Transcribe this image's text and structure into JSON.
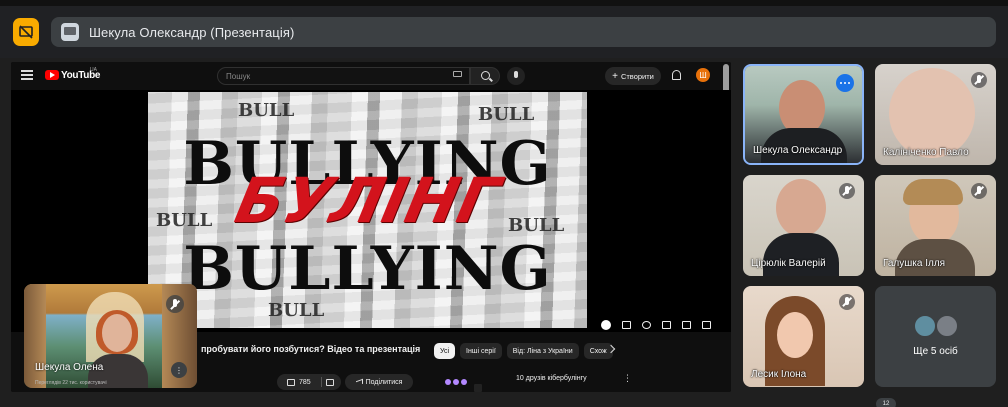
{
  "meeting": {
    "presenter_title": "Шекула Олександр (Презентація)",
    "accent_color": "#f9ab00",
    "pin_icon": "present-off-icon"
  },
  "youtube": {
    "brand": "YouTube",
    "region": "UA",
    "search_placeholder": "Пошук",
    "create_label": "Створити",
    "create_plus": "+",
    "avatar_letter": "Ш",
    "video": {
      "thumb_top": "BULLYING",
      "thumb_ua": "БУЛІНГ",
      "thumb_bottom": "BULLYING",
      "thumb_small": "BULL",
      "title": "пробувати його позбутися? Відео та презентація"
    },
    "likes": "785",
    "share_label": "Поділитися",
    "chips": [
      "Усі",
      "Інші серії",
      "Від: Ліна з України",
      "Схож"
    ],
    "recommended_text": "10 друзів кібербулінгу",
    "more_glyph": "⋮"
  },
  "self_view": {
    "name": "Шекула Олена",
    "sub": "Переглядів 22 тис. користувачі",
    "more_glyph": "⋮"
  },
  "participants": [
    {
      "name": "Шекула Олександр",
      "speaking": true
    },
    {
      "name": "Калініченко Павло",
      "muted": true
    },
    {
      "name": "Цірюлік Валерій",
      "muted": true
    },
    {
      "name": "Галушка Ілля",
      "muted": true
    },
    {
      "name": "Лесик Ілона",
      "muted": true
    }
  ],
  "others": {
    "label": "Ще 5 осіб"
  },
  "participants_count": "12"
}
